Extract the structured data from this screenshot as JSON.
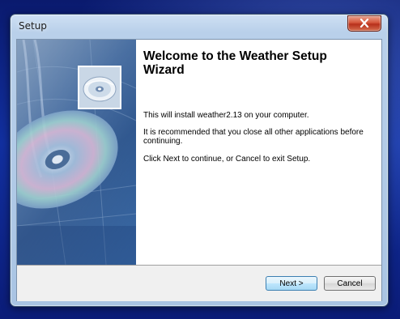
{
  "window": {
    "title": "Setup"
  },
  "wizard": {
    "heading": "Welcome to the Weather Setup Wizard",
    "line1": "This will install weather2.13 on your computer.",
    "line2": "It is recommended that you close all other applications before continuing.",
    "line3": "Click Next to continue, or Cancel to exit Setup."
  },
  "buttons": {
    "next": "Next >",
    "cancel": "Cancel"
  },
  "icons": {
    "close": "close-icon",
    "cd": "cd-icon"
  },
  "colors": {
    "desktop": "#1230a0",
    "side_panel": "#2f5a94",
    "close_button": "#d5553a",
    "default_button_border": "#3c7fb1"
  }
}
